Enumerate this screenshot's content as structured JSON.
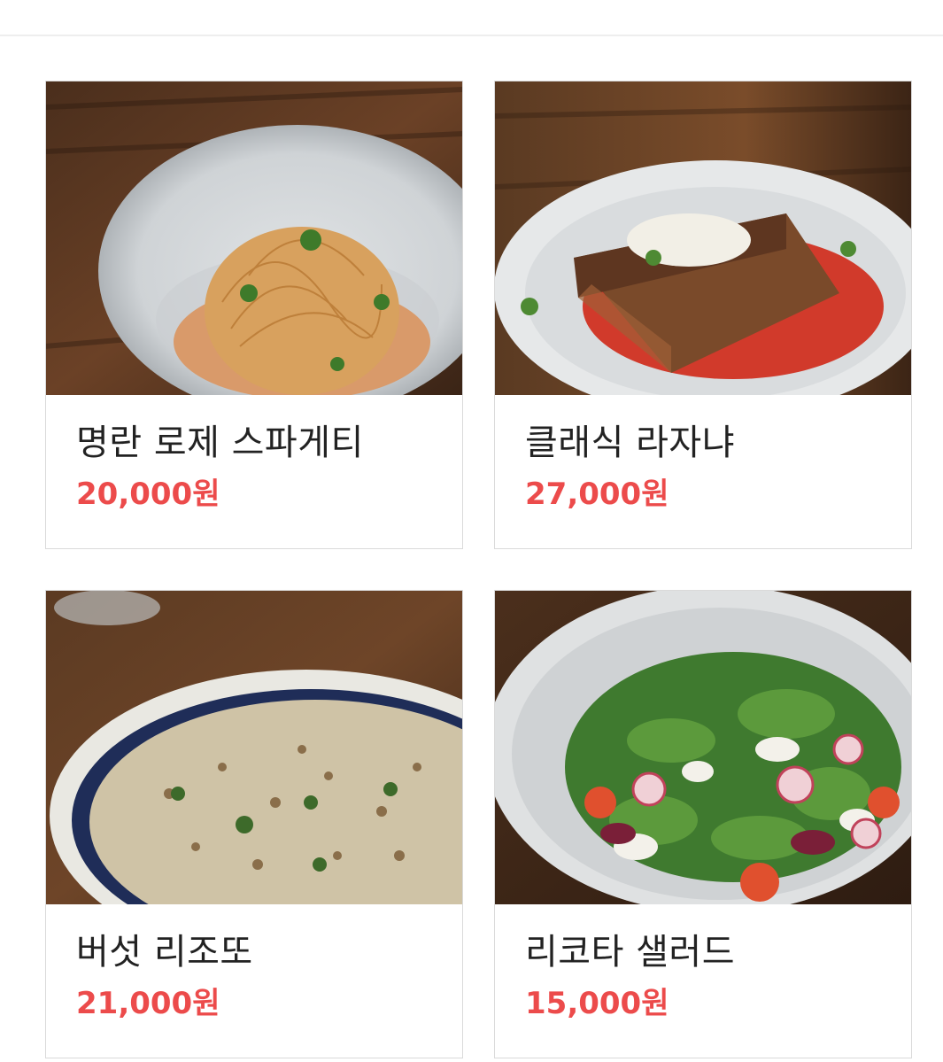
{
  "menu": {
    "items": [
      {
        "name": "명란 로제 스파게티",
        "price": "20,000원"
      },
      {
        "name": "클래식 라자냐",
        "price": "27,000원"
      },
      {
        "name": "버섯 리조또",
        "price": "21,000원"
      },
      {
        "name": "리코타 샐러드",
        "price": "15,000원"
      }
    ]
  },
  "colors": {
    "price": "#ec4b4b",
    "text": "#222222",
    "border": "#dadada"
  }
}
